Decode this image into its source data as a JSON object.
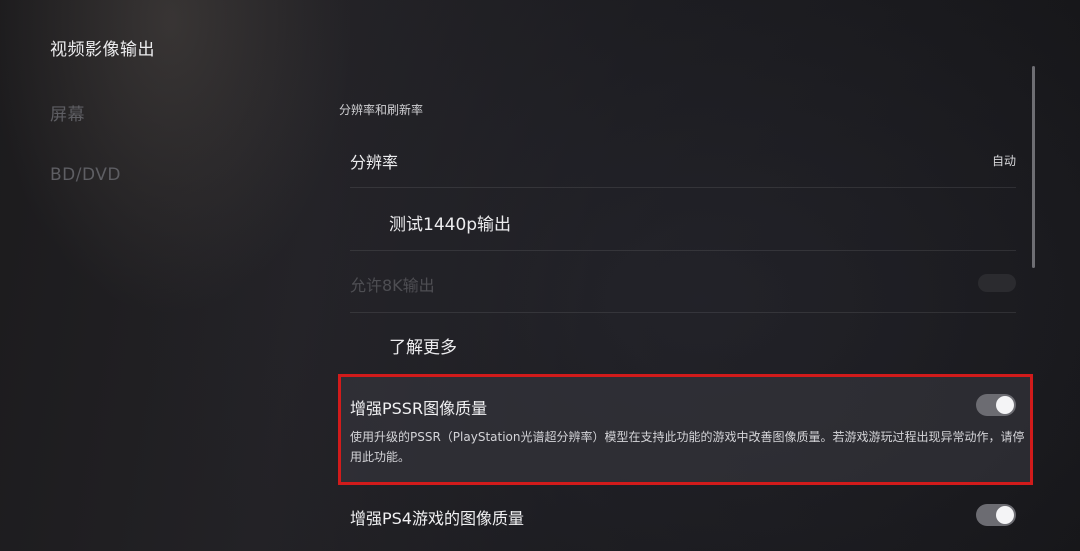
{
  "nav": {
    "items": [
      {
        "label": "视频影像输出"
      },
      {
        "label": "屏幕"
      },
      {
        "label": "BD/DVD"
      }
    ]
  },
  "content": {
    "section_title": "分辨率和刷新率",
    "resolution": {
      "label": "分辨率",
      "value": "自动"
    },
    "test_1440p": {
      "label": "测试1440p输出"
    },
    "allow_8k": {
      "label": "允许8K输出",
      "enabled": false
    },
    "learn_more": {
      "label": "了解更多"
    },
    "pssr": {
      "label": "增强PSSR图像质量",
      "description": "使用升级的PSSR（PlayStation光谱超分辨率）模型在支持此功能的游戏中改善图像质量。若游戏游玩过程出现异常动作，请停用此功能。",
      "toggle_on": true
    },
    "ps4_quality": {
      "label": "增强PS4游戏的图像质量",
      "toggle_on": true
    }
  },
  "colors": {
    "highlight_border": "#d11b1b",
    "toggle_on": "#6c6c72",
    "background": "#1a1a1e"
  }
}
